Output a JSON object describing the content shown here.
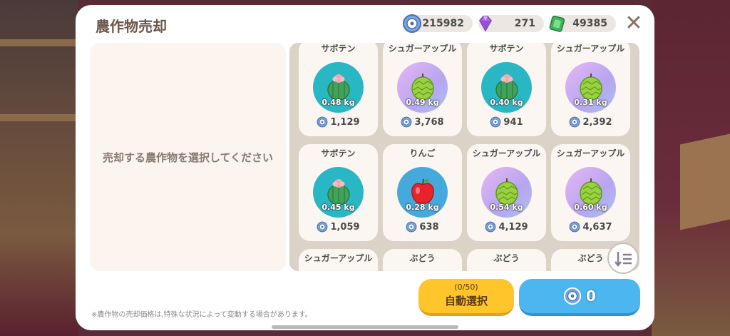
{
  "title": "農作物売却",
  "currencies": {
    "coins": "215982",
    "gems": "271",
    "tickets": "49385"
  },
  "close_label": "✕",
  "left_message": "売却する農作物を選択してください",
  "items": [
    {
      "name": "サボテン",
      "weight": "0.48 kg",
      "price": "1,129",
      "type": "cactus"
    },
    {
      "name": "シュガーアップル",
      "weight": "0.49 kg",
      "price": "3,768",
      "type": "sugar-apple"
    },
    {
      "name": "サボテン",
      "weight": "0.40 kg",
      "price": "941",
      "type": "cactus"
    },
    {
      "name": "シュガーアップル",
      "weight": "0.31 kg",
      "price": "2,392",
      "type": "sugar-apple"
    },
    {
      "name": "サボテン",
      "weight": "0.45 kg",
      "price": "1,059",
      "type": "cactus"
    },
    {
      "name": "りんご",
      "weight": "0.28 kg",
      "price": "638",
      "type": "apple"
    },
    {
      "name": "シュガーアップル",
      "weight": "0.54 kg",
      "price": "4,129",
      "type": "sugar-apple"
    },
    {
      "name": "シュガーアップル",
      "weight": "0.60 kg",
      "price": "4,637",
      "type": "sugar-apple"
    },
    {
      "name": "シュガーアップル",
      "weight": "",
      "price": "",
      "type": "sugar-apple"
    },
    {
      "name": "ぶどう",
      "weight": "",
      "price": "",
      "type": "grape"
    },
    {
      "name": "ぶどう",
      "weight": "",
      "price": "",
      "type": "grape"
    },
    {
      "name": "ぶどう",
      "weight": "",
      "price": "",
      "type": "grape"
    }
  ],
  "note": "※農作物の売却価格は,特殊な状況によって変動する場合があります。",
  "auto_select": {
    "count": "(0/50)",
    "label": "自動選択"
  },
  "sell_total": "0",
  "icons": {
    "coin": "coin-icon",
    "gem": "gem-icon",
    "ticket": "ticket-icon",
    "close": "close-icon",
    "sort": "sort-icon"
  },
  "colors": {
    "auto_button": "#ffc52a",
    "sell_button": "#4bb6ef",
    "title": "#6b5548"
  }
}
